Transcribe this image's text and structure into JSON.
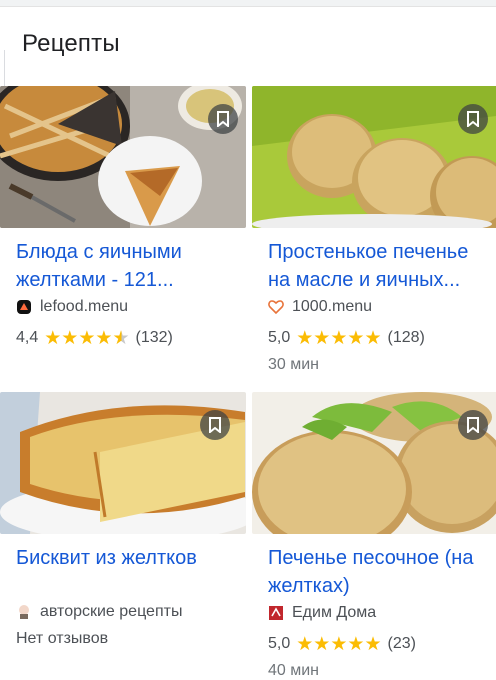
{
  "section": {
    "title": "Рецепты"
  },
  "colors": {
    "star": "#fbbc04",
    "link": "#1558d6",
    "save_bg": "#3c4043"
  },
  "cards": [
    {
      "title_line1": "Блюда с яичными",
      "title_line2": "желтками - 121...",
      "source": "lefood.menu",
      "source_icon": "lefood-logo-icon",
      "rating": "4,4",
      "stars": "4.5 of 5",
      "reviews": "(132)",
      "time": ""
    },
    {
      "title_line1": "Простенькое печенье",
      "title_line2": "на масле и яичных...",
      "source": "1000.menu",
      "source_icon": "heart-logo-icon",
      "rating": "5,0",
      "stars": "5 of 5",
      "reviews": "(128)",
      "time": "30 мин"
    },
    {
      "title_line1": "Бисквит из желтков",
      "title_line2": "",
      "source": "авторские рецепты",
      "source_icon": "chef-logo-icon",
      "rating": "",
      "reviews": "",
      "no_reviews": "Нет отзывов",
      "time": ""
    },
    {
      "title_line1": "Печенье песочное (на",
      "title_line2": "желтках)",
      "source": "Едим Дома",
      "source_icon": "edim-doma-logo-icon",
      "rating": "5,0",
      "stars": "5 of 5",
      "reviews": "(23)",
      "time": "40 мин"
    }
  ]
}
